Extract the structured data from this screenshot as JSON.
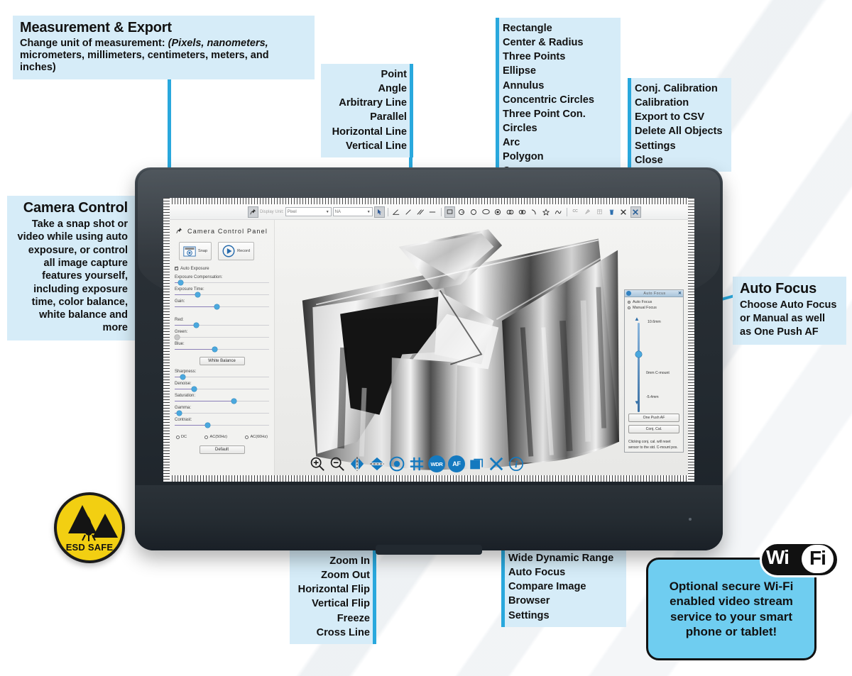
{
  "callouts": {
    "measurement_export": {
      "title": "Measurement & Export",
      "line1": "Change unit of measurement:",
      "line2": "(Pixels, nanometers,",
      "line3": "micrometers, millimeters, centimeters, meters, and inches)"
    },
    "camera_control": {
      "title": "Camera Control",
      "body": "Take a snap shot or video while using auto exposure, or control all image capture features yourself, including exposure time, color balance, white balance and more"
    },
    "auto_focus": {
      "title": "Auto Focus",
      "body": "Choose Auto Focus or Manual as well as One Push AF"
    },
    "wifi": {
      "logo_wi": "Wi",
      "logo_fi": "Fi",
      "text": "Optional secure Wi-Fi enabled video stream service to your smart phone or tablet!"
    },
    "esd": {
      "text": "ESD SAFE"
    }
  },
  "lists": {
    "measure_tools": [
      "Point",
      "Angle",
      "Arbitrary Line",
      "Parallel",
      "Horizontal Line",
      "Vertical Line"
    ],
    "shape_tools": [
      "Rectangle",
      "Center & Radius",
      "Three Points",
      "Ellipse",
      "Annulus",
      "Concentric Circles",
      "Three Point Con. Circles",
      "Arc",
      "Polygon",
      "Curve"
    ],
    "export_tools": [
      "Conj. Calibration",
      "Calibration",
      "Export to CSV",
      "Delete All Objects",
      "Settings",
      "Close"
    ],
    "view_tools": [
      "Zoom In",
      "Zoom Out",
      "Horizontal Flip",
      "Vertical Flip",
      "Freeze",
      "Cross Line"
    ],
    "camera_tools": [
      "Wide Dynamic Range",
      "Auto Focus",
      "Compare Image",
      "Browser",
      "Settings"
    ]
  },
  "screen": {
    "top_toolbar": {
      "unit_label": "Display Unit:",
      "unit_value": "Pixel",
      "unit_value2": "NA"
    },
    "camera_panel": {
      "title": "Camera Control Panel",
      "snap": "Snap",
      "record": "Record",
      "auto_exposure": "Auto Exposure",
      "sliders": [
        {
          "label": "Exposure Compensation:",
          "pos": 4
        },
        {
          "label": "Exposure Time:",
          "pos": 22
        },
        {
          "label": "Gain:",
          "pos": 42
        },
        {
          "label": "Red:",
          "pos": 20
        },
        {
          "label": "Green:",
          "pos": 0
        },
        {
          "label": "Blue:",
          "pos": 40
        },
        {
          "label": "Sharpness:",
          "pos": 6
        },
        {
          "label": "Denoise:",
          "pos": 18
        },
        {
          "label": "Saturation:",
          "pos": 60
        },
        {
          "label": "Gamma:",
          "pos": 2
        },
        {
          "label": "Contrast:",
          "pos": 32
        }
      ],
      "white_balance": "White Balance",
      "radios": [
        "DC",
        "AC(50Hz)",
        "AC(60Hz)"
      ],
      "default_btn": "Default"
    },
    "auto_focus_panel": {
      "title": "Auto Focus",
      "close": "✕",
      "opt_auto": "Auto Focus",
      "opt_manual": "Manual Focus",
      "top_value": "10.6mm",
      "mid_value": "0mm C-mount",
      "bottom_value": "-5.4mm",
      "btn_one_push": "One Push AF",
      "btn_conj_cal": "Conj. Cal.",
      "note": "Clicking conj. cal. will reset sensor to the std. C-mount pos."
    },
    "bottom_icons": [
      {
        "name": "zoom-in-icon",
        "label": "Zoom In"
      },
      {
        "name": "zoom-out-icon",
        "label": "Zoom Out"
      },
      {
        "name": "horizontal-flip-icon",
        "label": "Horizontal Flip"
      },
      {
        "name": "vertical-flip-icon",
        "label": "Vertical Flip"
      },
      {
        "name": "freeze-icon",
        "label": "Freeze"
      },
      {
        "name": "cross-line-icon",
        "label": "Cross Line"
      },
      {
        "name": "wdr-icon",
        "label": "WDR"
      },
      {
        "name": "af-icon",
        "label": "AF"
      },
      {
        "name": "compare-image-icon",
        "label": "Compare Image"
      },
      {
        "name": "browser-icon",
        "label": "Browser"
      },
      {
        "name": "info-settings-icon",
        "label": "Settings"
      }
    ]
  },
  "colors": {
    "accent": "#29a8dd",
    "callout_bg": "#d6ecf8",
    "wifi_box": "#6fcdf0",
    "esd_yellow": "#f2cf12",
    "icon_blue": "#1479bf"
  }
}
